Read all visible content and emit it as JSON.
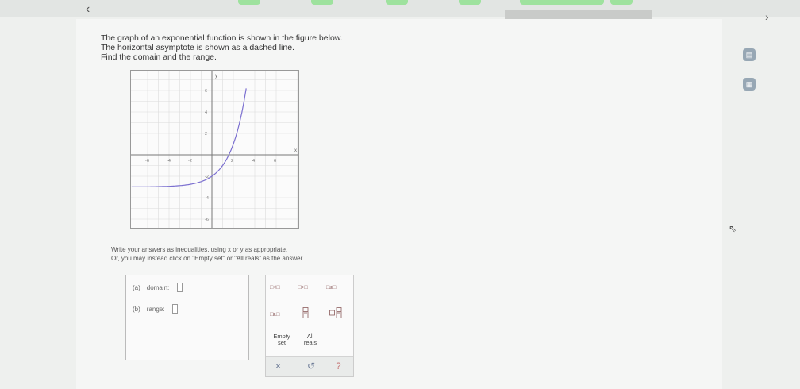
{
  "question": {
    "line1": "The graph of an exponential function is shown in the figure below.",
    "line2": "The horizontal asymptote is shown as a dashed line.",
    "line3": "Find the domain and the range."
  },
  "graph": {
    "x_ticks": [
      "-6",
      "-4",
      "-2",
      "2",
      "4",
      "6"
    ],
    "y_ticks": [
      "6",
      "4",
      "2",
      "-2",
      "-4",
      "-6"
    ],
    "x_label": "x",
    "y_label": "y",
    "asymptote_y": -3
  },
  "instructions": {
    "line1": "Write your answers as inequalities, using x or y as appropriate.",
    "line2": "Or, you may instead click on \"Empty set\" or \"All reals\" as the answer."
  },
  "answers": {
    "a_label": "(a)",
    "a_field": "domain:",
    "b_label": "(b)",
    "b_field": "range:"
  },
  "palette": {
    "lt": "□<□",
    "gt": "□>□",
    "le": "□≤□",
    "ge": "□≥□",
    "empty_set_1": "Empty",
    "empty_set_2": "set",
    "all_reals_1": "All",
    "all_reals_2": "reals",
    "clear": "×",
    "undo": "↺",
    "help": "?"
  },
  "colors": {
    "curve": "#7b6fd0",
    "accent_green": "#8fd88f"
  }
}
